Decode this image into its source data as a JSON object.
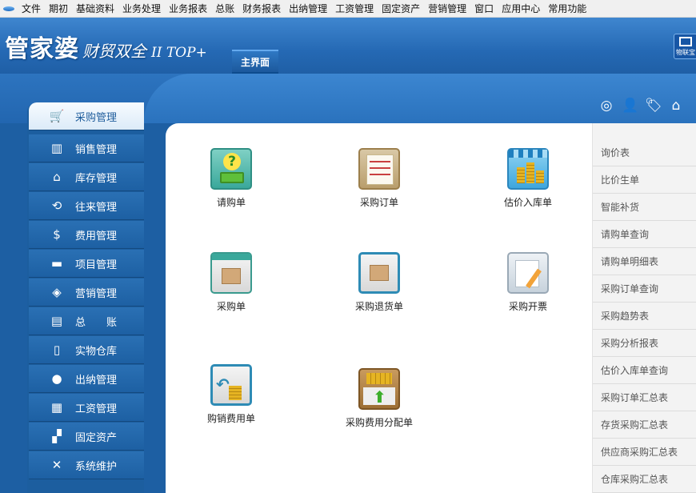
{
  "menubar": {
    "items": [
      "文件",
      "期初",
      "基础资料",
      "业务处理",
      "业务报表",
      "总账",
      "财务报表",
      "出纳管理",
      "工资管理",
      "固定资产",
      "营销管理",
      "窗口",
      "应用中心",
      "常用功能"
    ]
  },
  "header": {
    "brand_main": "管家婆",
    "brand_sub": "财贸双全",
    "brand_version": "II TOP+",
    "active_tab": "主界面",
    "iot_label": "物联宝"
  },
  "top_icons": [
    "globe-icon",
    "user-icon",
    "tag-icon",
    "home-icon"
  ],
  "sidebar": {
    "items": [
      {
        "label": "采购管理",
        "icon": "cart-icon",
        "glyph": "🛒",
        "active": true
      },
      {
        "label": "销售管理",
        "icon": "bar-chart-icon",
        "glyph": "▥",
        "active": false
      },
      {
        "label": "库存管理",
        "icon": "house-icon",
        "glyph": "⌂",
        "active": false
      },
      {
        "label": "往来管理",
        "icon": "refresh-icon",
        "glyph": "⟲",
        "active": false
      },
      {
        "label": "费用管理",
        "icon": "dollar-icon",
        "glyph": "$",
        "active": false
      },
      {
        "label": "项目管理",
        "icon": "folder-icon",
        "glyph": "▬",
        "active": false
      },
      {
        "label": "营销管理",
        "icon": "tags-icon",
        "glyph": "◈",
        "active": false
      },
      {
        "label": "总　　账",
        "icon": "card-icon",
        "glyph": "▤",
        "active": false
      },
      {
        "label": "实物仓库",
        "icon": "document-icon",
        "glyph": "▯",
        "active": false
      },
      {
        "label": "出纳管理",
        "icon": "moneybag-icon",
        "glyph": "●",
        "active": false
      },
      {
        "label": "工资管理",
        "icon": "grid-icon",
        "glyph": "▦",
        "active": false
      },
      {
        "label": "固定资产",
        "icon": "boxes-icon",
        "glyph": "▞",
        "active": false
      },
      {
        "label": "系统维护",
        "icon": "tools-icon",
        "glyph": "✕",
        "active": false
      }
    ]
  },
  "functions": [
    {
      "label": "请购单",
      "icon": "requisition-icon"
    },
    {
      "label": "采购订单",
      "icon": "purchase-order-icon"
    },
    {
      "label": "估价入库单",
      "icon": "estimated-receipt-icon"
    },
    {
      "label": "采购单",
      "icon": "purchase-slip-icon"
    },
    {
      "label": "采购退货单",
      "icon": "purchase-return-icon"
    },
    {
      "label": "采购开票",
      "icon": "purchase-invoice-icon"
    },
    {
      "label": "购销费用单",
      "icon": "expense-slip-icon"
    },
    {
      "label": "采购费用分配单",
      "icon": "expense-allocation-icon"
    }
  ],
  "right_list": {
    "items": [
      "询价表",
      "比价生单",
      "智能补货",
      "请购单查询",
      "请购单明细表",
      "采购订单查询",
      "采购趋势表",
      "采购分析报表",
      "估价入库单查询",
      "采购订单汇总表",
      "存货采购汇总表",
      "供应商采购汇总表",
      "仓库采购汇总表"
    ]
  },
  "colors": {
    "brand_blue": "#2569b4",
    "panel": "#ffffff",
    "active_item": "#dcebf8"
  }
}
